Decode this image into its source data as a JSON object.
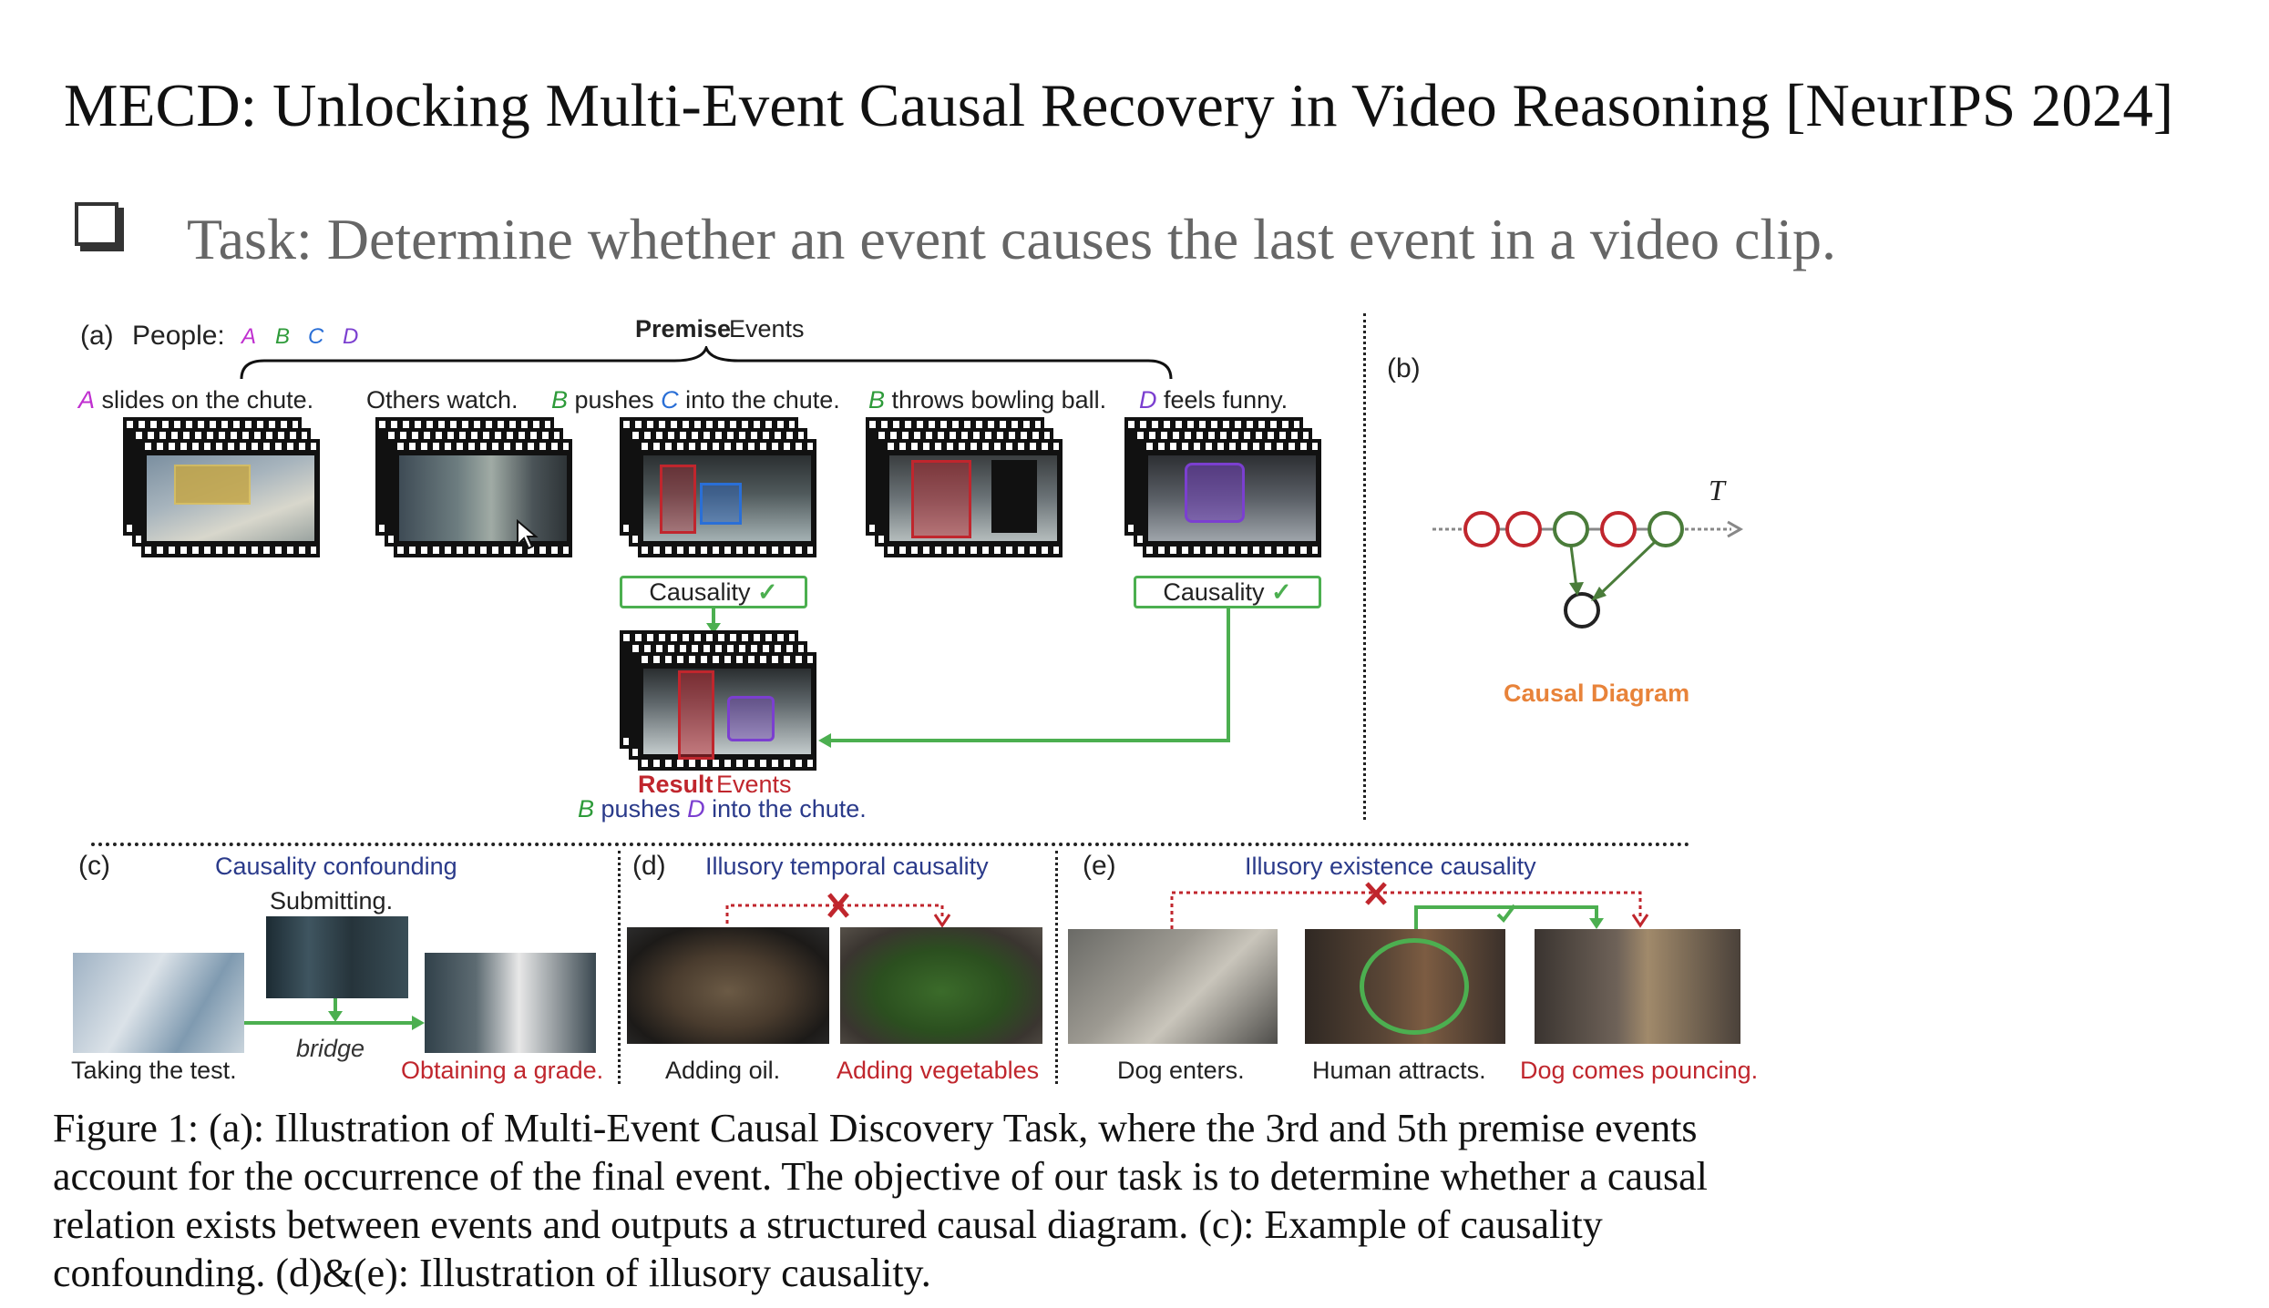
{
  "slide": {
    "title": "MECD: Unlocking Multi-Event Causal Recovery in Video Reasoning [NeurIPS 2024]",
    "task": "Task: Determine whether an event causes the last event in a video clip."
  },
  "panel_a": {
    "label": "(a)",
    "people_label": "People:",
    "people": [
      "A",
      "B",
      "C",
      "D"
    ],
    "premise_word1": "Premise",
    "premise_word2": "Events",
    "events": [
      {
        "person": "A",
        "text": "slides on the chute."
      },
      {
        "person": "",
        "text": "Others watch."
      },
      {
        "person": "B",
        "text": "pushes",
        "person2": "C",
        "text2": "into the chute."
      },
      {
        "person": "B",
        "text": "throws bowling ball."
      },
      {
        "person": "D",
        "text": "feels funny."
      }
    ],
    "causality_label": "Causality",
    "check_mark": "✓",
    "result_word1": "Result",
    "result_word2": "Events",
    "result_person": "B",
    "result_text1": "pushes",
    "result_person2": "D",
    "result_text2": "into the chute."
  },
  "panel_b": {
    "label": "(b)",
    "t_label": "T",
    "diagram_label": "Causal Diagram"
  },
  "panel_c": {
    "label": "(c)",
    "title": "Causality confounding",
    "middle": "Submitting.",
    "bridge": "bridge",
    "left": "Taking the test.",
    "right": "Obtaining a grade."
  },
  "panel_d": {
    "label": "(d)",
    "title": "Illusory temporal causality",
    "left": "Adding oil.",
    "right": "Adding vegetables"
  },
  "panel_e": {
    "label": "(e)",
    "title": "Illusory existence causality",
    "left": "Dog enters.",
    "middle": "Human attracts.",
    "right": "Dog comes pouncing."
  },
  "caption": "Figure 1: (a): Illustration of Multi-Event Causal Discovery Task, where the 3rd and 5th premise events account for the occurrence of the final event. The objective of our task is to determine whether a causal relation exists between events and outputs a structured causal diagram. (c): Example of causality confounding. (d)&(e): Illustration of illusory causality.",
  "colors": {
    "A": "#c030d0",
    "B": "#2e9b3a",
    "C": "#2a6fd6",
    "D": "#7b3fd0",
    "green": "#4caf50",
    "red": "#c0262d",
    "orange": "#e8833a",
    "navy": "#2a3a8a"
  },
  "icons": [
    "checkbox-icon",
    "check-icon",
    "cross-icon",
    "mouse-cursor-icon"
  ]
}
